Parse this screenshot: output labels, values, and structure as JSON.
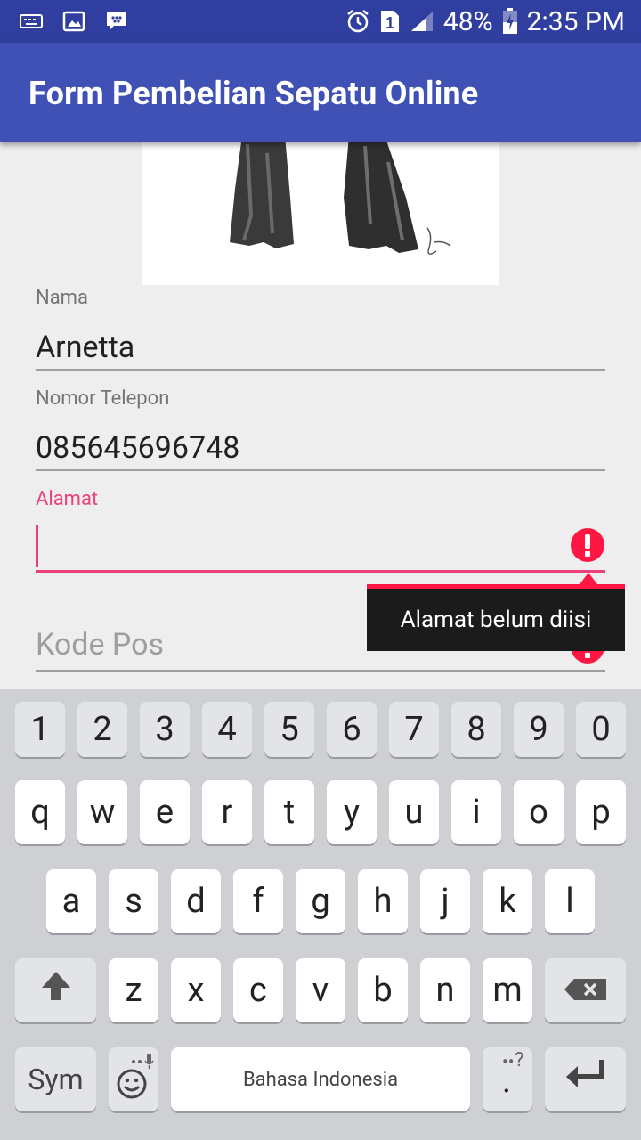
{
  "status_bar": {
    "battery_percent": "48%",
    "time": "2:35 PM",
    "sim_slot": "1"
  },
  "app_bar": {
    "title": "Form Pembelian Sepatu Online"
  },
  "form": {
    "nama": {
      "label": "Nama",
      "value": "Arnetta"
    },
    "telepon": {
      "label": "Nomor Telepon",
      "value": "085645696748"
    },
    "alamat": {
      "label": "Alamat",
      "value": "",
      "error": "Alamat belum diisi"
    },
    "kode_pos": {
      "placeholder": "Kode Pos"
    }
  },
  "keyboard": {
    "numbers": [
      "1",
      "2",
      "3",
      "4",
      "5",
      "6",
      "7",
      "8",
      "9",
      "0"
    ],
    "row1": [
      "q",
      "w",
      "e",
      "r",
      "t",
      "y",
      "u",
      "i",
      "o",
      "p"
    ],
    "row2": [
      "a",
      "s",
      "d",
      "f",
      "g",
      "h",
      "j",
      "k",
      "l"
    ],
    "row3": [
      "z",
      "x",
      "c",
      "v",
      "b",
      "n",
      "m"
    ],
    "sym_label": "Sym",
    "space_label": "Bahasa Indonesia",
    "period_label": ".",
    "period_hint": "?"
  },
  "colors": {
    "primary": "#3f51b5",
    "primary_dark": "#303f9f",
    "accent": "#ec407a",
    "error": "#ff1744"
  }
}
